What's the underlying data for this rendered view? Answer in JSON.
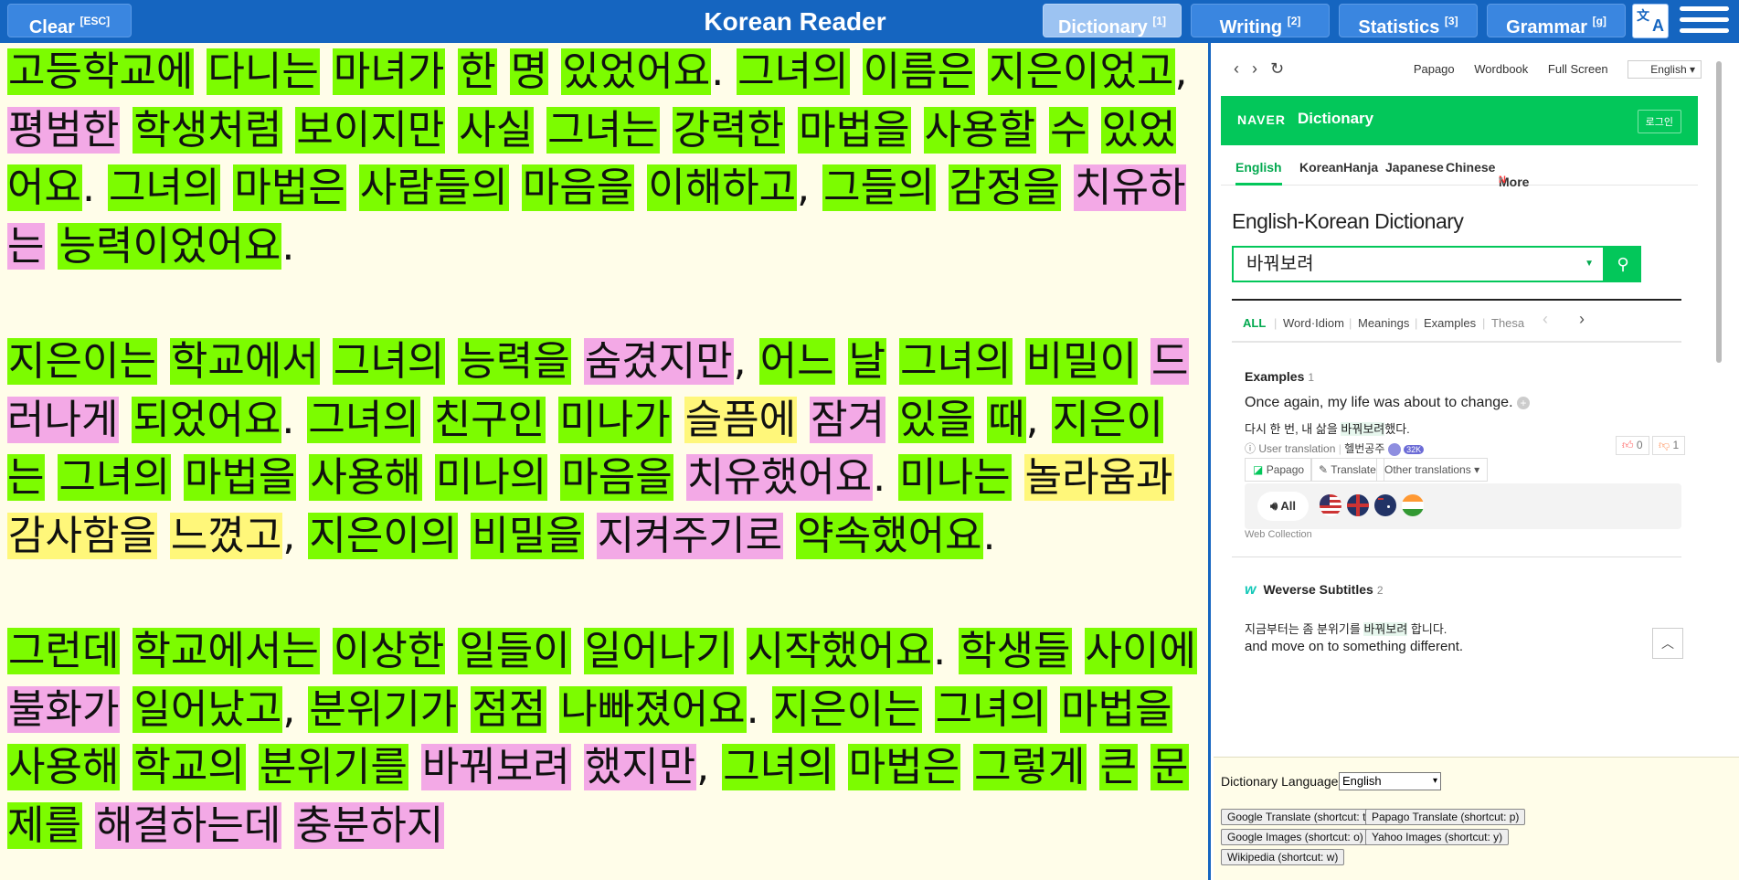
{
  "topbar": {
    "clear_label": "Clear",
    "clear_shortcut": "[ESC]",
    "title": "Korean Reader",
    "tabs": [
      {
        "label": "Dictionary",
        "shortcut": "[1]"
      },
      {
        "label": "Writing",
        "shortcut": "[2]"
      },
      {
        "label": "Statistics",
        "shortcut": "[3]"
      },
      {
        "label": "Grammar",
        "shortcut": "[g]"
      }
    ]
  },
  "reader": {
    "paragraphs": [
      [
        {
          "t": "고등학교에",
          "c": "g"
        },
        {
          "t": " "
        },
        {
          "t": "다니는",
          "c": "g"
        },
        {
          "t": " "
        },
        {
          "t": "마녀가",
          "c": "g"
        },
        {
          "t": " "
        },
        {
          "t": "한",
          "c": "g"
        },
        {
          "t": " "
        },
        {
          "t": "명",
          "c": "g"
        },
        {
          "t": " "
        },
        {
          "t": "있었어요",
          "c": "g"
        },
        {
          "t": ". "
        },
        {
          "t": "그녀의",
          "c": "g"
        },
        {
          "t": " "
        },
        {
          "t": "이름은",
          "c": "g"
        },
        {
          "t": " "
        },
        {
          "t": "지은이었고",
          "c": "g"
        },
        {
          "t": ", "
        },
        {
          "t": "평범한",
          "c": "p"
        },
        {
          "t": " "
        },
        {
          "t": "학생처럼",
          "c": "g"
        },
        {
          "t": " "
        },
        {
          "t": "보이지만",
          "c": "g"
        },
        {
          "t": " "
        },
        {
          "t": "사실",
          "c": "g"
        },
        {
          "t": " "
        },
        {
          "t": "그녀는",
          "c": "g"
        },
        {
          "t": " "
        },
        {
          "t": "강력한",
          "c": "g"
        },
        {
          "t": " "
        },
        {
          "t": "마법을",
          "c": "g"
        },
        {
          "t": " "
        },
        {
          "t": "사용할",
          "c": "g"
        },
        {
          "t": " "
        },
        {
          "t": "수",
          "c": "g"
        },
        {
          "t": " "
        },
        {
          "t": "있었어요",
          "c": "g"
        },
        {
          "t": ". "
        },
        {
          "t": "그녀의",
          "c": "g"
        },
        {
          "t": " "
        },
        {
          "t": "마법은",
          "c": "g"
        },
        {
          "t": " "
        },
        {
          "t": "사람들의",
          "c": "g"
        },
        {
          "t": " "
        },
        {
          "t": "마음을",
          "c": "g"
        },
        {
          "t": " "
        },
        {
          "t": "이해하고",
          "c": "g"
        },
        {
          "t": ", "
        },
        {
          "t": "그들의",
          "c": "g"
        },
        {
          "t": " "
        },
        {
          "t": "감정을",
          "c": "g"
        },
        {
          "t": " "
        },
        {
          "t": "치유하는",
          "c": "p"
        },
        {
          "t": " "
        },
        {
          "t": "능력이었어요",
          "c": "g"
        },
        {
          "t": "."
        }
      ],
      [
        {
          "t": "지은이는",
          "c": "g"
        },
        {
          "t": " "
        },
        {
          "t": "학교에서",
          "c": "g"
        },
        {
          "t": " "
        },
        {
          "t": "그녀의",
          "c": "g"
        },
        {
          "t": " "
        },
        {
          "t": "능력을",
          "c": "g"
        },
        {
          "t": " "
        },
        {
          "t": "숨겼지만",
          "c": "p"
        },
        {
          "t": ", "
        },
        {
          "t": "어느",
          "c": "g"
        },
        {
          "t": " "
        },
        {
          "t": "날",
          "c": "g"
        },
        {
          "t": " "
        },
        {
          "t": "그녀의",
          "c": "g"
        },
        {
          "t": " "
        },
        {
          "t": "비밀이",
          "c": "g"
        },
        {
          "t": " "
        },
        {
          "t": "드러나게",
          "c": "p"
        },
        {
          "t": " "
        },
        {
          "t": "되었어요",
          "c": "g"
        },
        {
          "t": ". "
        },
        {
          "t": "그녀의",
          "c": "g"
        },
        {
          "t": " "
        },
        {
          "t": "친구인",
          "c": "g"
        },
        {
          "t": " "
        },
        {
          "t": "미나가",
          "c": "g"
        },
        {
          "t": " "
        },
        {
          "t": "슬픔에",
          "c": "y"
        },
        {
          "t": " "
        },
        {
          "t": "잠겨",
          "c": "p"
        },
        {
          "t": " "
        },
        {
          "t": "있을",
          "c": "g"
        },
        {
          "t": " "
        },
        {
          "t": "때",
          "c": "g"
        },
        {
          "t": ", "
        },
        {
          "t": "지은이는",
          "c": "g"
        },
        {
          "t": " "
        },
        {
          "t": "그녀의",
          "c": "g"
        },
        {
          "t": " "
        },
        {
          "t": "마법을",
          "c": "g"
        },
        {
          "t": " "
        },
        {
          "t": "사용해",
          "c": "g"
        },
        {
          "t": " "
        },
        {
          "t": "미나의",
          "c": "g"
        },
        {
          "t": " "
        },
        {
          "t": "마음을",
          "c": "g"
        },
        {
          "t": " "
        },
        {
          "t": "치유했어요",
          "c": "p"
        },
        {
          "t": ". "
        },
        {
          "t": "미나는",
          "c": "g"
        },
        {
          "t": " "
        },
        {
          "t": "놀라움과",
          "c": "y"
        },
        {
          "t": " "
        },
        {
          "t": "감사함을",
          "c": "y"
        },
        {
          "t": " "
        },
        {
          "t": "느꼈고",
          "c": "y"
        },
        {
          "t": ", "
        },
        {
          "t": "지은이의",
          "c": "g"
        },
        {
          "t": " "
        },
        {
          "t": "비밀을",
          "c": "g"
        },
        {
          "t": " "
        },
        {
          "t": "지켜주기로",
          "c": "p"
        },
        {
          "t": " "
        },
        {
          "t": "약속했어요",
          "c": "g"
        },
        {
          "t": "."
        }
      ],
      [
        {
          "t": "그런데",
          "c": "g"
        },
        {
          "t": " "
        },
        {
          "t": "학교에서는",
          "c": "g"
        },
        {
          "t": " "
        },
        {
          "t": "이상한",
          "c": "g"
        },
        {
          "t": " "
        },
        {
          "t": "일들이",
          "c": "g"
        },
        {
          "t": " "
        },
        {
          "t": "일어나기",
          "c": "g"
        },
        {
          "t": " "
        },
        {
          "t": "시작했어요",
          "c": "g"
        },
        {
          "t": ". "
        },
        {
          "t": "학생들",
          "c": "g"
        },
        {
          "t": " "
        },
        {
          "t": "사이에",
          "c": "g"
        },
        {
          "t": " "
        },
        {
          "t": "불화가",
          "c": "p"
        },
        {
          "t": " "
        },
        {
          "t": "일어났고",
          "c": "g"
        },
        {
          "t": ", "
        },
        {
          "t": "분위기가",
          "c": "g"
        },
        {
          "t": " "
        },
        {
          "t": "점점",
          "c": "g"
        },
        {
          "t": " "
        },
        {
          "t": "나빠졌어요",
          "c": "g"
        },
        {
          "t": ". "
        },
        {
          "t": "지은이는",
          "c": "g"
        },
        {
          "t": " "
        },
        {
          "t": "그녀의",
          "c": "g"
        },
        {
          "t": " "
        },
        {
          "t": "마법을",
          "c": "g"
        },
        {
          "t": " "
        },
        {
          "t": "사용해",
          "c": "g"
        },
        {
          "t": " "
        },
        {
          "t": "학교의",
          "c": "g"
        },
        {
          "t": " "
        },
        {
          "t": "분위기를",
          "c": "g"
        },
        {
          "t": " "
        },
        {
          "t": "바꿔보려",
          "c": "p"
        },
        {
          "t": " "
        },
        {
          "t": "했지만",
          "c": "p"
        },
        {
          "t": ", "
        },
        {
          "t": "그녀의",
          "c": "g"
        },
        {
          "t": " "
        },
        {
          "t": "마법은",
          "c": "g"
        },
        {
          "t": " "
        },
        {
          "t": "그렇게",
          "c": "g"
        },
        {
          "t": " "
        },
        {
          "t": "큰",
          "c": "g"
        },
        {
          "t": " "
        },
        {
          "t": "문제를",
          "c": "g"
        },
        {
          "t": " "
        },
        {
          "t": "해결하는데",
          "c": "p"
        },
        {
          "t": " "
        },
        {
          "t": "충분하지",
          "c": "p"
        }
      ]
    ]
  },
  "dict": {
    "nav_links": [
      "Papago",
      "Wordbook",
      "Full Screen"
    ],
    "nav_lang": "English",
    "brand": "NAVER",
    "brand_title": "Dictionary",
    "login": "로그인",
    "lang_tabs": [
      "English",
      "Korean",
      "Hanja",
      "Japanese",
      "Chinese",
      "More"
    ],
    "more_badge": "N",
    "heading": "English-Korean Dictionary",
    "query": "바꿔보려",
    "result_tabs": [
      "ALL",
      "Word·Idiom",
      "Meanings",
      "Examples",
      "Thesa"
    ],
    "examples_title": "Examples",
    "examples_count": "1",
    "example_en": "Once again, my life was about to change.",
    "example_ko_pre": "다시 한 번, 내 삶을 ",
    "example_ko_hl": "바꿔보려",
    "example_ko_post": "했다.",
    "user_translation": "User translation",
    "translator": "헬번공주",
    "translator_badge": "32K",
    "like_count": "0",
    "dislike_count": "1",
    "tool_papago": "Papago",
    "tool_translate": "Translate",
    "tool_other": "Other translations",
    "audio_all": "All",
    "web_collection": "Web Collection",
    "weverse_title": "Weverse Subtitles",
    "weverse_count": "2",
    "wv_ko_pre": "지금부터는 좀 분위기를 ",
    "wv_ko_hl": "바꿔보려",
    "wv_ko_post": " 합니다.",
    "wv_en": "and move on to something different."
  },
  "bottom": {
    "dict_lang_label": "Dictionary Language:",
    "dict_lang_value": "English",
    "buttons": [
      "Google Translate (shortcut: t)",
      "Papago Translate (shortcut: p)",
      "Google Images (shortcut: o)",
      "Yahoo Images (shortcut: y)",
      "Wikipedia (shortcut: w)"
    ]
  },
  "colors": {
    "topbar": "#1565c0",
    "known": "#7cfc00",
    "unknown": "#f3a9e6",
    "learning": "#fff77a",
    "naver_green": "#03c75a"
  }
}
